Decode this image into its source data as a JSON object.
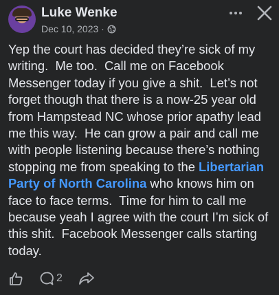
{
  "post": {
    "author": "Luke Wenke",
    "date": "Dec 10, 2023 ·",
    "text_part1": "Yep the court has decided they’re sick of my writing.  Me too.  Call me on Facebook Messenger today if you give a shit.  Let’s not forget though that there is a now-25 year old from Hampstead NC whose prior apathy lead me this way.  He can grow a pair and call me with people listening because there’s nothing stopping me from speaking to the ",
    "link_text": "Libertarian Party of North Carolina",
    "text_part2": " who knows him on face to face terms.  Time for him to call me because yeah I agree with the court I’m sick of this shit.  Facebook Messenger calls starting today.",
    "comment_count": "2"
  },
  "icons": {
    "audience": "globe-icon",
    "more": "more-options-icon",
    "close": "close-icon",
    "like": "like-icon",
    "comment": "comment-icon",
    "share": "share-icon"
  },
  "colors": {
    "background": "#242526",
    "text": "#e4e6eb",
    "secondary": "#b0b3b8",
    "link": "#4599ff"
  }
}
